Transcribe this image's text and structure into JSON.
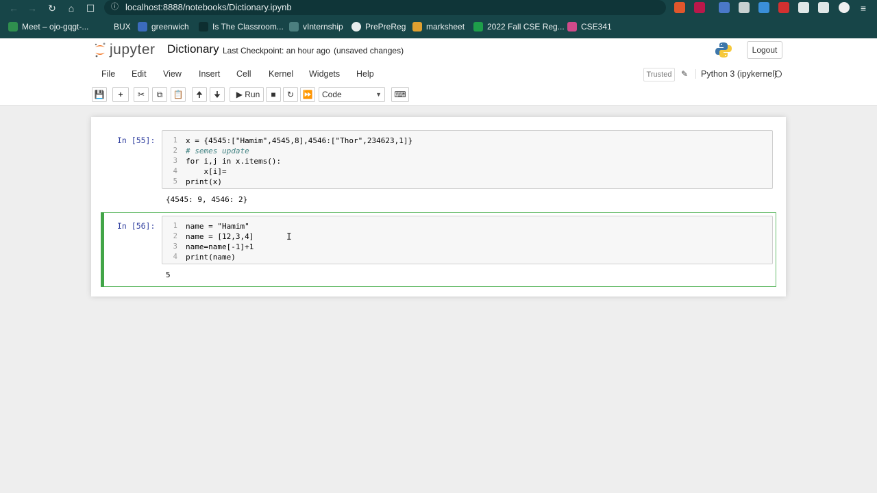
{
  "browser": {
    "url": "localhost:8888/notebooks/Dictionary.ipynb",
    "bookmarks": [
      {
        "label": "Meet – ojo-gqgt-...",
        "color": "#2f8f4e"
      },
      {
        "label": "BUX",
        "color": "#888888"
      },
      {
        "label": "greenwich",
        "color": "#3b6bbd"
      },
      {
        "label": "Is The Classroom...",
        "color": "#222222"
      },
      {
        "label": "vInternship",
        "color": "#4b7f7f"
      },
      {
        "label": "PrePreReg",
        "color": "#ffffff"
      },
      {
        "label": "marksheet",
        "color": "#e0a030"
      },
      {
        "label": "2022 Fall CSE Reg...",
        "color": "#1e9e4a"
      },
      {
        "label": "CSE341",
        "color": "#d04a8a"
      }
    ]
  },
  "jupyter": {
    "logo_text": "jupyter",
    "notebook_title": "Dictionary",
    "checkpoint": "Last Checkpoint: an hour ago",
    "unsaved": "(unsaved changes)",
    "logout_label": "Logout",
    "menu": [
      "File",
      "Edit",
      "View",
      "Insert",
      "Cell",
      "Kernel",
      "Widgets",
      "Help"
    ],
    "trusted_label": "Trusted",
    "kernel_name": "Python 3 (ipykernel)",
    "toolbar": {
      "run_label": "Run",
      "cell_type": "Code"
    }
  },
  "cells": [
    {
      "prompt": "In [55]:",
      "lines": [
        "x = {4545:[\"Hamim\",4545,8],4546:[\"Thor\",234623,1]}",
        "# semes update",
        "for i,j in x.items():",
        "    x[i]=",
        "print(x)"
      ],
      "output": "{4545: 9, 4546: 2}"
    },
    {
      "prompt": "In [56]:",
      "lines": [
        "name = \"Hamim\"",
        "name = [12,3,4]",
        "name=name[-1]+1",
        "print(name)"
      ],
      "output": "5"
    }
  ]
}
